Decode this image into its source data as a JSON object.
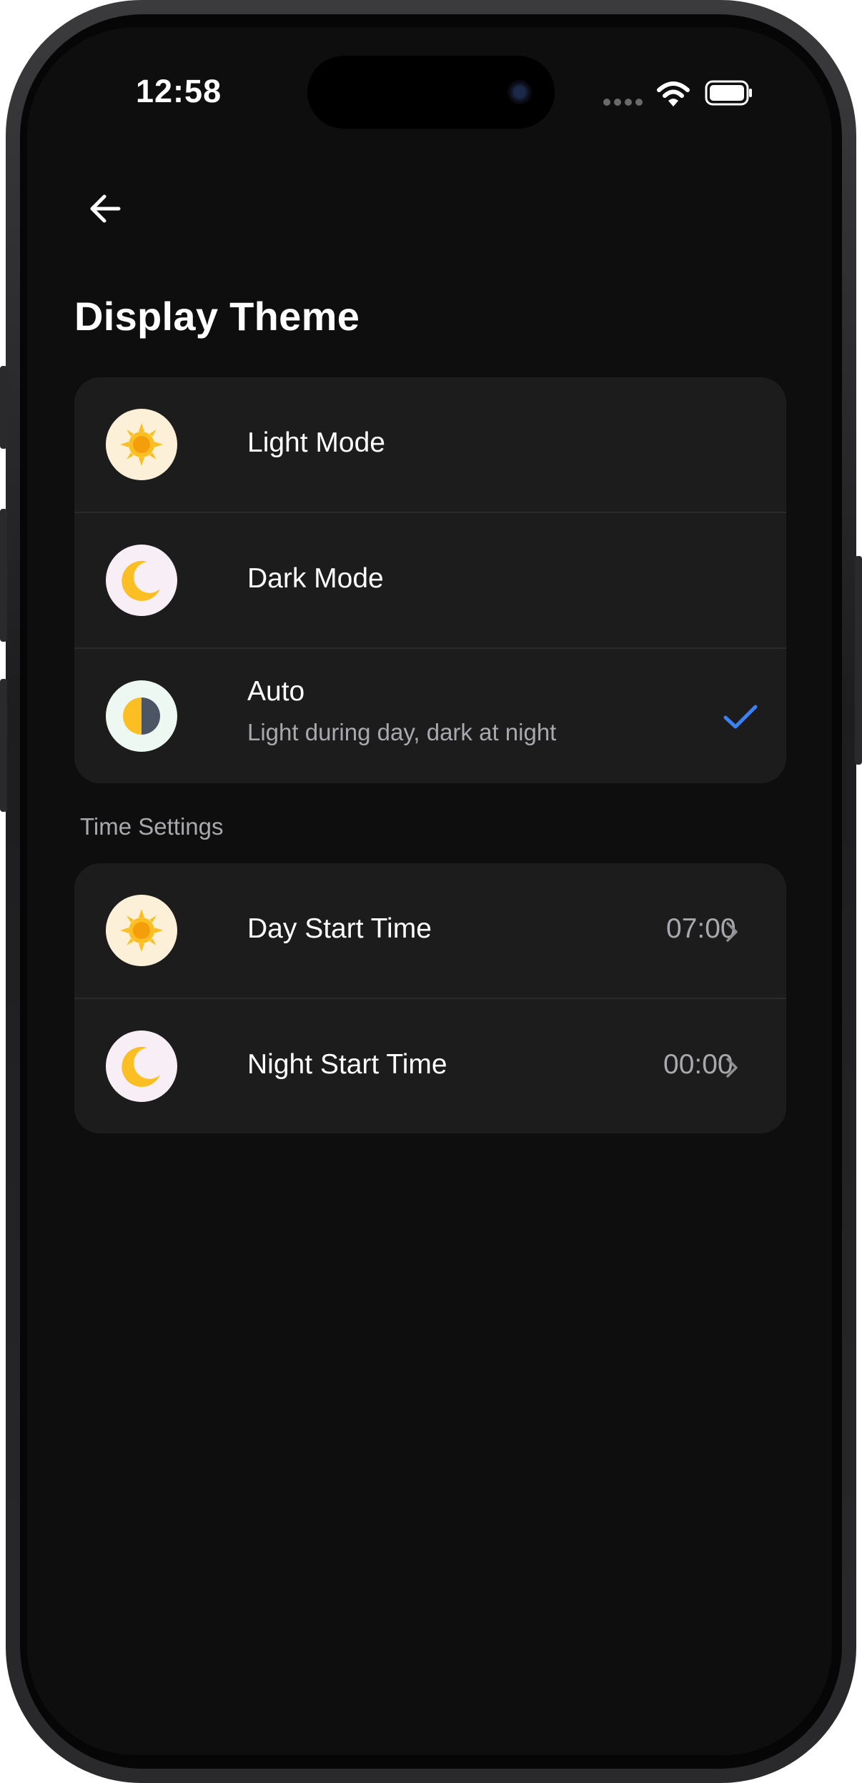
{
  "status_bar": {
    "time": "12:58"
  },
  "page": {
    "title": "Display Theme"
  },
  "theme_options": [
    {
      "label": "Light Mode",
      "subtitle": "",
      "icon": "sun-icon",
      "selected": false
    },
    {
      "label": "Dark Mode",
      "subtitle": "",
      "icon": "moon-icon",
      "selected": false
    },
    {
      "label": "Auto",
      "subtitle": "Light during day, dark at night",
      "icon": "half-circle-icon",
      "selected": true
    }
  ],
  "time_settings": {
    "section_label": "Time Settings",
    "items": [
      {
        "label": "Day Start Time",
        "value": "07:00",
        "icon": "sun-icon"
      },
      {
        "label": "Night Start Time",
        "value": "00:00",
        "icon": "moon-icon"
      }
    ]
  },
  "colors": {
    "background": "#0e0e0e",
    "card": "#1c1c1c",
    "accent": "#3b82f6",
    "sun": "#fbbf24",
    "sun_core": "#f59e0b"
  }
}
